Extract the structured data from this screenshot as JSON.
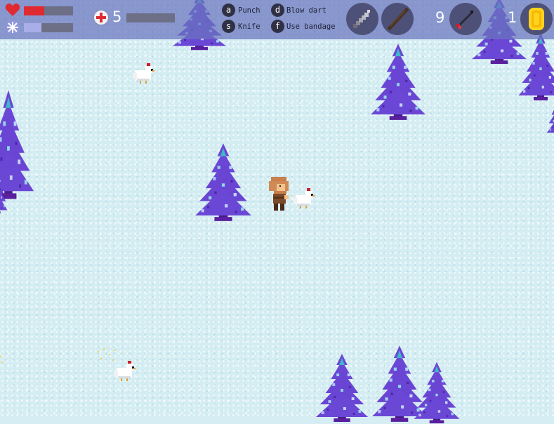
{
  "hud": {
    "health_level": 0.42,
    "cold_level": 0.35,
    "bandage_count": "5",
    "bandage_progress": 0.0,
    "actions": [
      {
        "key": "a",
        "label": "Punch"
      },
      {
        "key": "s",
        "label": "Knife"
      },
      {
        "key": "d",
        "label": "Blow dart"
      },
      {
        "key": "f",
        "label": "Use bandage"
      }
    ],
    "dart_count": "9",
    "coin_count": "1"
  },
  "colors": {
    "health": "#e02a32",
    "cold": "#a9aee9",
    "hud_bg": "#6a74be",
    "tree": "#6b47d6",
    "coin": "#ffd21f"
  },
  "icons": {
    "health": "heart-icon",
    "cold": "snowflake-icon",
    "bandage": "bandage-icon",
    "knife": "knife-icon",
    "blowgun": "blowgun-icon",
    "dart": "dart-icon",
    "coin": "coin-icon"
  }
}
